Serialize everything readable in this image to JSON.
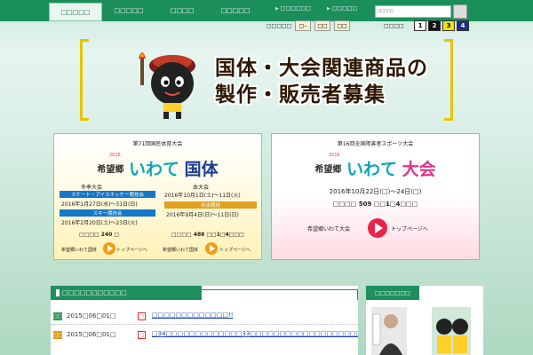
{
  "nav": {
    "items": [
      {
        "label": "□□□□□",
        "active": true
      },
      {
        "label": "□□□□□",
        "active": false
      },
      {
        "label": "□□□□",
        "active": false
      },
      {
        "label": "□□□□□",
        "active": false
      }
    ],
    "sublinks": [
      "□□□□□□",
      "□□□□□"
    ],
    "search_placeholder": "□□□□□"
  },
  "tools": {
    "font_label": "□□□□□",
    "font_buttons": [
      "□–",
      "□□",
      "□□"
    ],
    "color_label": "□□□□",
    "color_buttons": [
      {
        "label": "1",
        "bg": "#ffffff",
        "fg": "#000000"
      },
      {
        "label": "2",
        "bg": "#111111",
        "fg": "#ffffff"
      },
      {
        "label": "3",
        "bg": "#f5e400",
        "fg": "#000000"
      },
      {
        "label": "4",
        "bg": "#1c2f8a",
        "fg": "#ffffff"
      }
    ]
  },
  "banner": {
    "line1": "国体・大会関連商品の",
    "line2": "製作・販売者募集"
  },
  "kokutai": {
    "title": "第71回国民体育大会",
    "year": "2016",
    "kibou": "希望郷",
    "iwate": "いわて",
    "name": "国体",
    "winter_label": "冬季大会",
    "winter_events": [
      {
        "label": "スケート・アイスホッケー競技会",
        "date": "2016年1月27日(水)～31日(日)"
      },
      {
        "label": "スキー競技会",
        "date": "2016年2月20日(土)～23日(火)"
      }
    ],
    "main_label": "本大会",
    "main_date": "2016年10月1日(土)～11日(火)",
    "swim_label": "水泳競技",
    "swim_date": "2016年9月4日(日)～11日(日)",
    "countdown_left": "□□□□ 240 □",
    "countdown_right": "□□□□ 488 □□1□4□□□",
    "footer_left": "希望郷いわて国体",
    "footer_right": "トップページへ",
    "footer_left2": "希望郷いわて国体",
    "footer_right2": "トップページへ"
  },
  "taikai": {
    "title": "第16回全国障害者スポーツ大会",
    "year": "2016",
    "kibou": "希望郷",
    "iwate": "いわて",
    "name": "大会",
    "date": "2016年10月22日(□)～24日(□)",
    "countdown": "□□□□ 509 □□1□4□□□",
    "footer_left": "希望郷いわて大会",
    "footer_right": "トップページへ"
  },
  "news": {
    "header": "□□□□□□□□□□□",
    "rows": [
      {
        "icon": "□□",
        "icon_color": "#2f9b5a",
        "date": "2015□06□01□",
        "tag": "□",
        "text": "□□□□□□□□□□□□□!!"
      },
      {
        "icon": "□□",
        "icon_color": "#e0a020",
        "date": "2015□06□01□",
        "tag": "□",
        "text": "□34□□□□□□□□□□□□□33□□□□□□□□□□□□□□□□□□□□□□□□"
      }
    ]
  },
  "side": {
    "header": "□□□□□□□"
  }
}
